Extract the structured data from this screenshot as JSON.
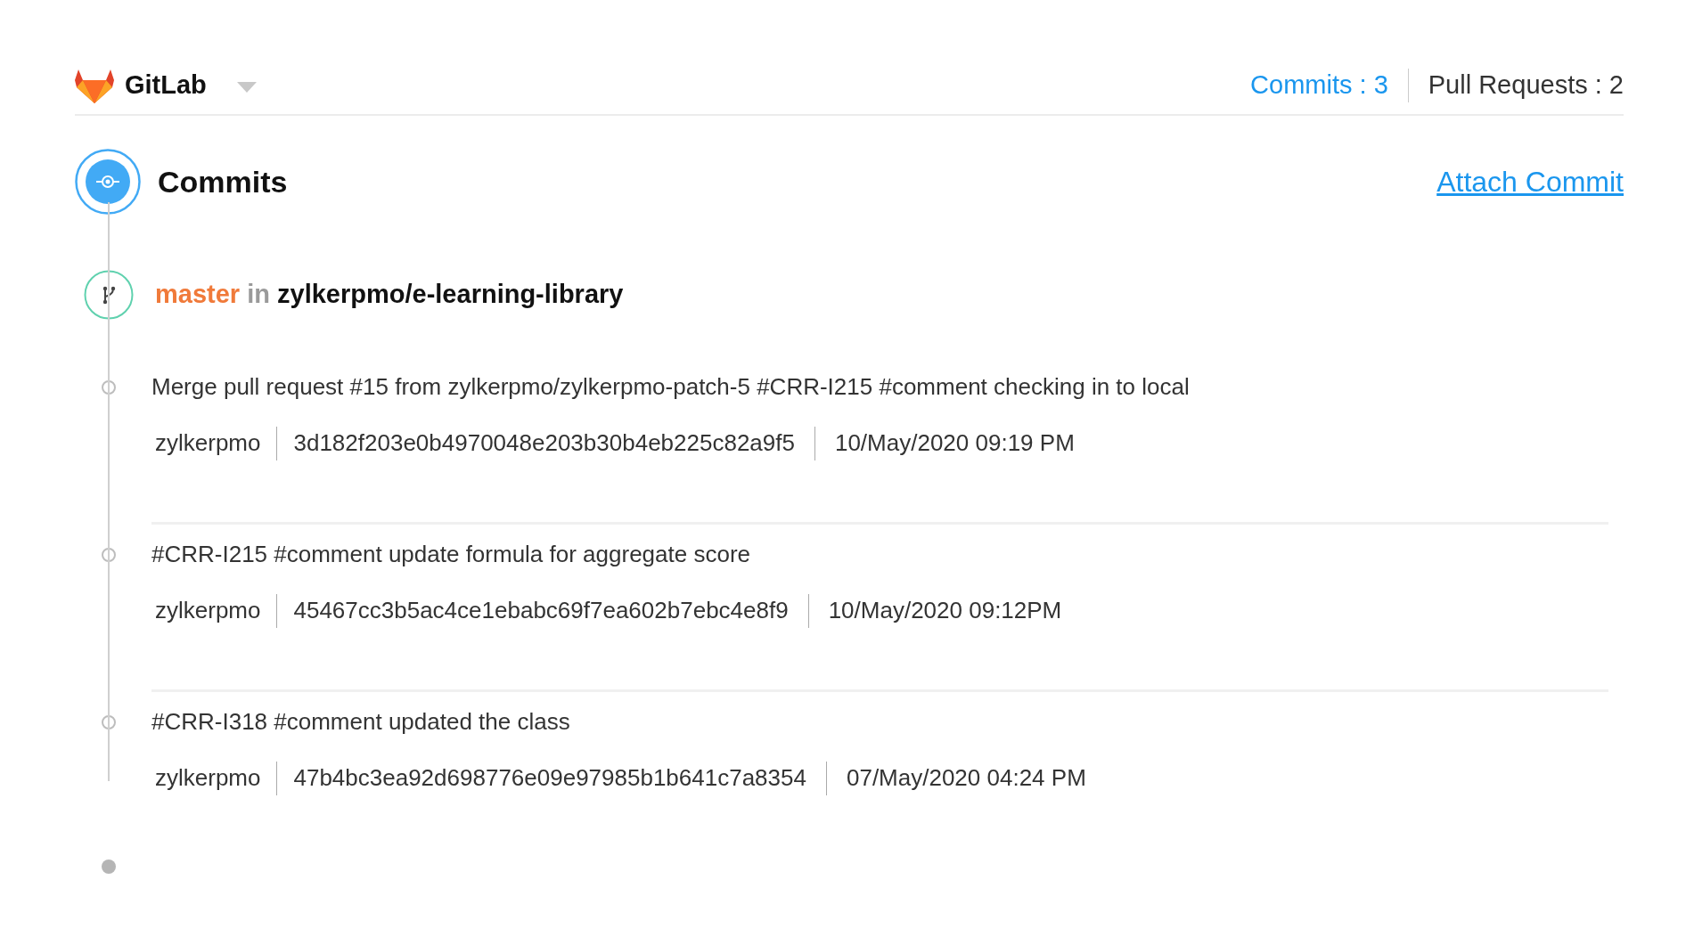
{
  "header": {
    "app_name": "GitLab",
    "tabs": [
      {
        "label": "Commits : 3",
        "selected": true
      },
      {
        "label": "Pull Requests : 2",
        "selected": false
      }
    ]
  },
  "section": {
    "title": "Commits",
    "action": "Attach Commit"
  },
  "branch": {
    "name": "master",
    "connector": "in",
    "repository": "zylkerpmo/e-learning-library"
  },
  "commits": [
    {
      "message": "Merge pull request #15 from zylkerpmo/zylkerpmo-patch-5 #CRR-I215 #comment checking in to local",
      "author": "zylkerpmo",
      "hash": "3d182f203e0b4970048e203b30b4eb225c82a9f5",
      "date": "10/May/2020 09:19 PM"
    },
    {
      "message": "#CRR-I215 #comment update formula for aggregate score",
      "author": "zylkerpmo",
      "hash": "45467cc3b5ac4ce1ebabc69f7ea602b7ebc4e8f9",
      "date": "10/May/2020 09:12PM"
    },
    {
      "message": "#CRR-I318 #comment updated the class",
      "author": "zylkerpmo",
      "hash": "47b4bc3ea92d698776e09e97985b1b641c7a8354",
      "date": "07/May/2020 04:24 PM"
    }
  ]
}
